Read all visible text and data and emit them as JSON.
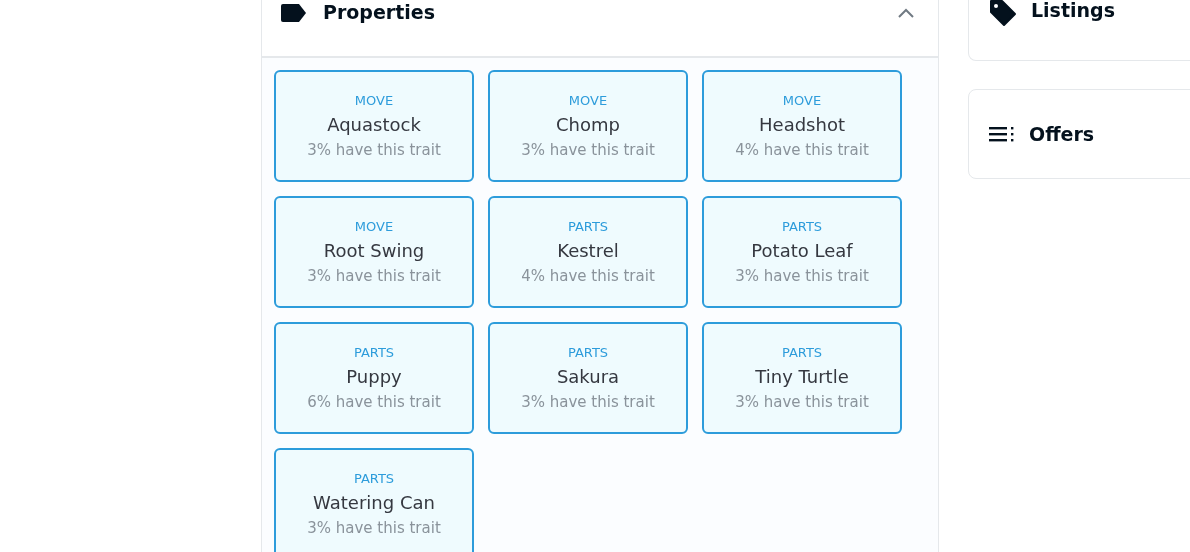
{
  "properties_panel": {
    "title": "Properties",
    "expanded": true,
    "traits": [
      {
        "type": "MOVE",
        "value": "Aquastock",
        "share": "3% have this trait"
      },
      {
        "type": "MOVE",
        "value": "Chomp",
        "share": "3% have this trait"
      },
      {
        "type": "MOVE",
        "value": "Headshot",
        "share": "4% have this trait"
      },
      {
        "type": "MOVE",
        "value": "Root Swing",
        "share": "3% have this trait"
      },
      {
        "type": "PARTS",
        "value": "Kestrel",
        "share": "4% have this trait"
      },
      {
        "type": "PARTS",
        "value": "Potato Leaf",
        "share": "3% have this trait"
      },
      {
        "type": "PARTS",
        "value": "Puppy",
        "share": "6% have this trait"
      },
      {
        "type": "PARTS",
        "value": "Sakura",
        "share": "3% have this trait"
      },
      {
        "type": "PARTS",
        "value": "Tiny Turtle",
        "share": "3% have this trait"
      },
      {
        "type": "PARTS",
        "value": "Watering Can",
        "share": "3% have this trait"
      }
    ]
  },
  "side_panels": [
    {
      "kind": "listings",
      "title": "Listings"
    },
    {
      "kind": "offers",
      "title": "Offers"
    }
  ]
}
